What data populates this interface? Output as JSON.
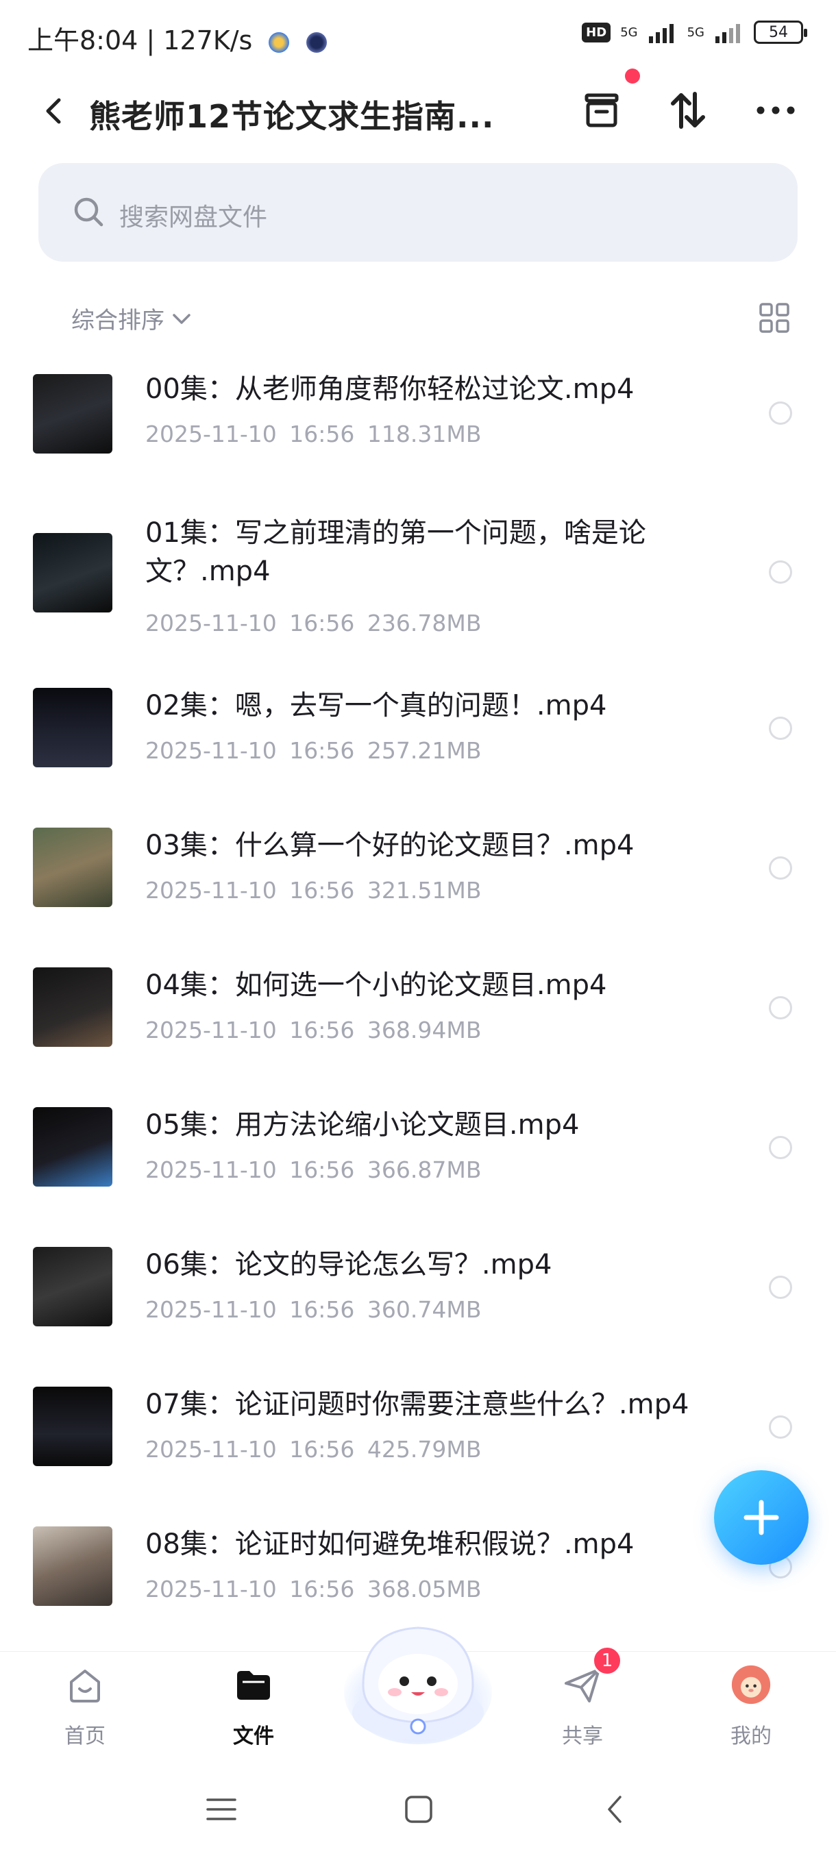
{
  "status_bar": {
    "left_text": "上午8:04 | 127K/s",
    "hd_label": "HD",
    "signal1": "5G",
    "signal2": "5G",
    "battery": "54"
  },
  "header": {
    "title": "熊老师12节论文求生指南..."
  },
  "search": {
    "placeholder": "搜索网盘文件"
  },
  "sort": {
    "label": "综合排序"
  },
  "files": [
    {
      "name": "00集：从老师角度帮你轻松过论文.mp4",
      "date": "2025-11-10",
      "time": "16:56",
      "size": "118.31MB"
    },
    {
      "name": "01集：写之前理清的第一个问题，啥是论文？.mp4",
      "date": "2025-11-10",
      "time": "16:56",
      "size": "236.78MB"
    },
    {
      "name": "02集：嗯，去写一个真的问题！.mp4",
      "date": "2025-11-10",
      "time": "16:56",
      "size": "257.21MB"
    },
    {
      "name": "03集：什么算一个好的论文题目？.mp4",
      "date": "2025-11-10",
      "time": "16:56",
      "size": "321.51MB"
    },
    {
      "name": "04集：如何选一个小的论文题目.mp4",
      "date": "2025-11-10",
      "time": "16:56",
      "size": "368.94MB"
    },
    {
      "name": "05集：用方法论缩小论文题目.mp4",
      "date": "2025-11-10",
      "time": "16:56",
      "size": "366.87MB"
    },
    {
      "name": "06集：论文的导论怎么写？.mp4",
      "date": "2025-11-10",
      "time": "16:56",
      "size": "360.74MB"
    },
    {
      "name": "07集：论证问题时你需要注意些什么？.mp4",
      "date": "2025-11-10",
      "time": "16:56",
      "size": "425.79MB"
    },
    {
      "name": "08集：论证时如何避免堆积假说？.mp4",
      "date": "2025-11-10",
      "time": "16:56",
      "size": "368.05MB"
    }
  ],
  "bottom_nav": {
    "home": "首页",
    "files": "文件",
    "share": "共享",
    "mine": "我的",
    "share_badge": "1"
  },
  "colors": {
    "accent": "#1a8fff",
    "badge": "#ff3b5c",
    "meta_text": "#a5a8b2"
  }
}
